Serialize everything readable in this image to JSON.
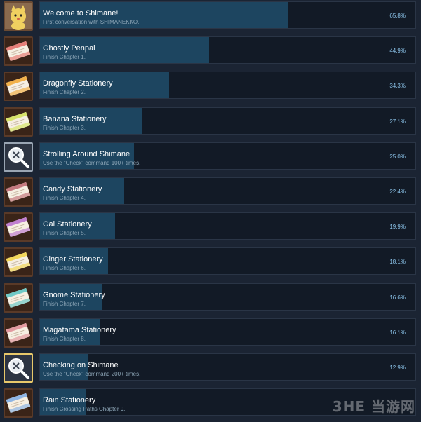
{
  "achievements": [
    {
      "title": "Welcome to Shimane!",
      "description": "First conversation with SHIMANEKKO.",
      "percent_label": "65.8%",
      "percent": 65.8,
      "icon": "shimanekko-cat-icon",
      "icon_color": "#f0d060"
    },
    {
      "title": "Ghostly Penpal",
      "description": "Finish Chapter 1.",
      "percent_label": "44.9%",
      "percent": 44.9,
      "icon": "envelope-icon",
      "icon_color": "#e77f78"
    },
    {
      "title": "Dragonfly Stationery",
      "description": "Finish Chapter 2.",
      "percent_label": "34.3%",
      "percent": 34.3,
      "icon": "envelope-icon",
      "icon_color": "#f2b14a"
    },
    {
      "title": "Banana Stationery",
      "description": "Finish Chapter 3.",
      "percent_label": "27.1%",
      "percent": 27.1,
      "icon": "envelope-icon",
      "icon_color": "#d7e26a"
    },
    {
      "title": "Strolling Around Shimane",
      "description": "Use the \"Check\" command 100+ times.",
      "percent_label": "25.0%",
      "percent": 25.0,
      "icon": "magnifier-icon",
      "icon_color": "#9aa5b3"
    },
    {
      "title": "Candy Stationery",
      "description": "Finish Chapter 4.",
      "percent_label": "22.4%",
      "percent": 22.4,
      "icon": "envelope-icon",
      "icon_color": "#c57a7f"
    },
    {
      "title": "Gal Stationery",
      "description": "Finish Chapter 5.",
      "percent_label": "19.9%",
      "percent": 19.9,
      "icon": "envelope-icon",
      "icon_color": "#c07fd0"
    },
    {
      "title": "Ginger Stationery",
      "description": "Finish Chapter 6.",
      "percent_label": "18.1%",
      "percent": 18.1,
      "icon": "envelope-icon",
      "icon_color": "#f2d65a"
    },
    {
      "title": "Gnome Stationery",
      "description": "Finish Chapter 7.",
      "percent_label": "16.6%",
      "percent": 16.6,
      "icon": "envelope-icon",
      "icon_color": "#6fc9c6"
    },
    {
      "title": "Magatama Stationery",
      "description": "Finish Chapter 8.",
      "percent_label": "16.1%",
      "percent": 16.1,
      "icon": "envelope-icon",
      "icon_color": "#e29aa0"
    },
    {
      "title": "Checking on Shimane",
      "description": "Use the \"Check\" command 200+ times.",
      "percent_label": "12.9%",
      "percent": 12.9,
      "icon": "magnifier-icon",
      "icon_color": "#e8c86a"
    },
    {
      "title": "Rain Stationery",
      "description": "Finish Crossing Paths Chapter 9.",
      "percent_label": "",
      "percent": 12.1,
      "icon": "envelope-icon",
      "icon_color": "#8eb5e4"
    }
  ],
  "watermark": "3HE 当游网"
}
